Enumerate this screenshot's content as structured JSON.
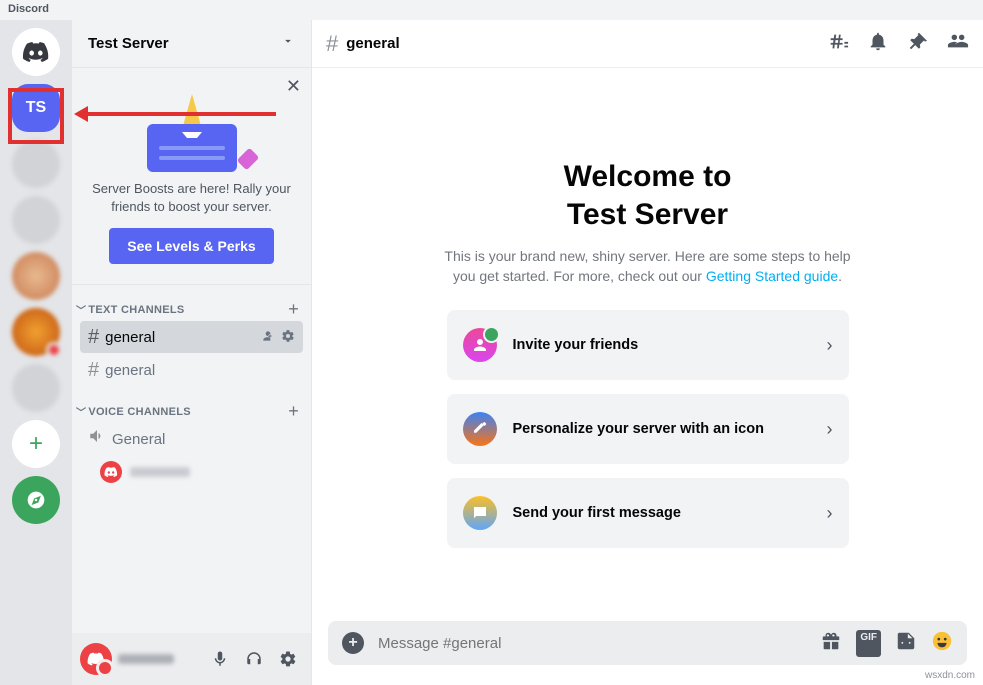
{
  "app": {
    "title": "Discord"
  },
  "serverRail": {
    "activeServerInitials": "TS",
    "addLabel": "+"
  },
  "sidebar": {
    "serverName": "Test Server",
    "boost": {
      "text": "Server Boosts are here! Rally your friends to boost your server.",
      "button": "See Levels & Perks"
    },
    "textHeader": "TEXT CHANNELS",
    "voiceHeader": "VOICE CHANNELS",
    "textChannels": [
      {
        "name": "general",
        "active": true
      },
      {
        "name": "general",
        "active": false
      }
    ],
    "voiceChannels": [
      {
        "name": "General"
      }
    ]
  },
  "header": {
    "channel": "general"
  },
  "welcome": {
    "line1": "Welcome to",
    "line2": "Test Server",
    "subPrefix": "This is your brand new, shiny server. Here are some steps to help you get started. For more, check out our ",
    "link": "Getting Started guide",
    "subSuffix": "."
  },
  "cards": [
    {
      "label": "Invite your friends"
    },
    {
      "label": "Personalize your server with an icon"
    },
    {
      "label": "Send your first message"
    }
  ],
  "composer": {
    "placeholder": "Message #general"
  },
  "watermark": "wsxdn.com"
}
